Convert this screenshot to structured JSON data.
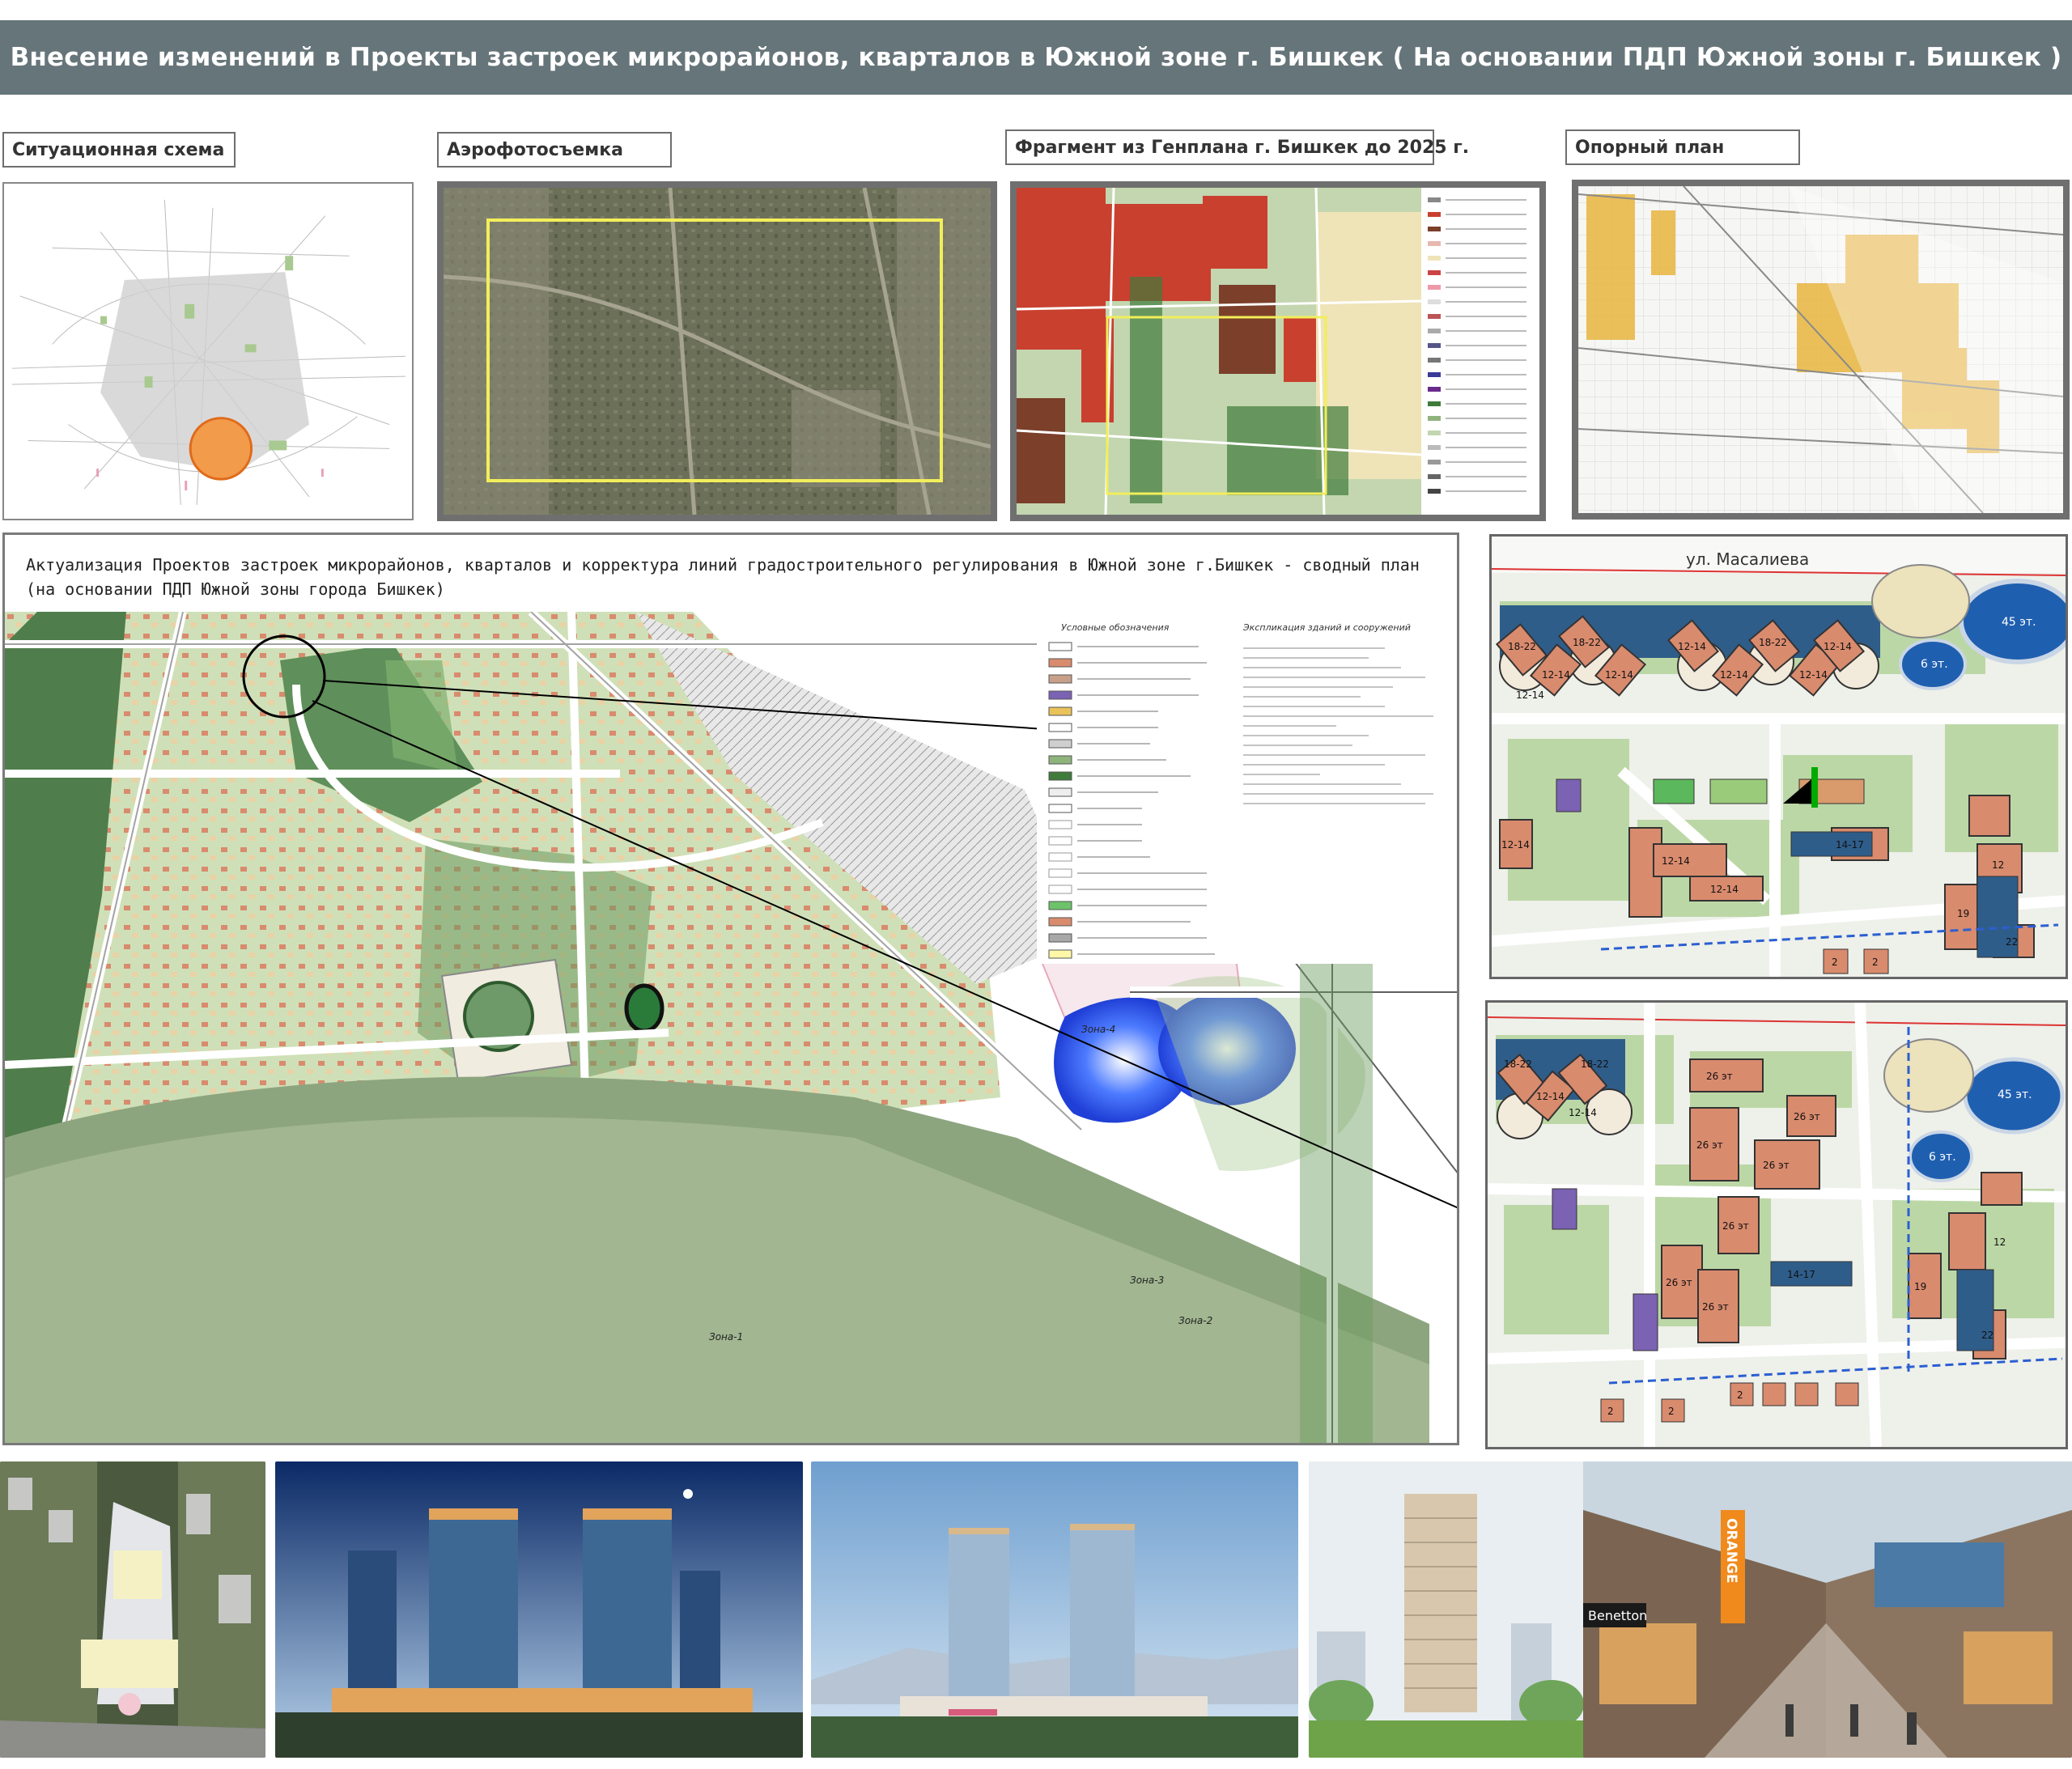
{
  "header": {
    "title": "Внесение изменений в  Проекты застроек микрорайонов, кварталов в Южной зоне г. Бишкек  ( На основании ПДП  Южной зоны г. Бишкек )"
  },
  "top_labels": {
    "situation": "Ситуационная схема",
    "aerial": "Аэрофотосъемка",
    "genplan": "Фрагмент из Генплана г. Бишкек до 2025 г.",
    "base_plan": "Опорный план"
  },
  "main_plan": {
    "title_line1": "Актуализация Проектов застроек микрорайонов, кварталов и корректура линий градостроительного регулирования в Южной  зоне  г.Бишкек - сводный план",
    "title_line2": "(на основании ПДП Южной зоны города Бишкек)",
    "legend_heading": "Условные обозначения",
    "explication_heading": "Экспликация зданий и сооружений",
    "zones": [
      "Зона-1",
      "Зона-2",
      "Зона-3",
      "Зона-4"
    ]
  },
  "detail_top": {
    "street": "ул. Масалиева",
    "floors": [
      "18-22",
      "18-22",
      "18-22",
      "12-14",
      "12-14",
      "12-14",
      "12-14",
      "12-14",
      "12-14",
      "12-14",
      "12-14",
      "14-17",
      "12-14",
      "12-14",
      "12",
      "19",
      "22",
      "2",
      "2"
    ],
    "ellipse_labels": [
      "45 эт.",
      "6 эт."
    ]
  },
  "detail_bottom": {
    "floors": [
      "18-22",
      "18-22",
      "12-14",
      "12-14",
      "26 эт",
      "26 эт",
      "26 эт",
      "26 эт",
      "26 эт",
      "26 эт",
      "26 эт",
      "14-17",
      "12",
      "19",
      "22",
      "2",
      "2",
      "2"
    ],
    "ellipse_labels": [
      "45 эт.",
      "6 эт."
    ]
  },
  "photos": {
    "mall_sign": "ORANGE",
    "mall_store": "Benetton"
  },
  "colors": {
    "banner": "#66757a",
    "frame": "#6f6f6f",
    "building": "#d98b6e",
    "tower_blue": "#2f5d8a",
    "green": "#8fb37d",
    "yellow_outline": "#f2ee5a"
  }
}
